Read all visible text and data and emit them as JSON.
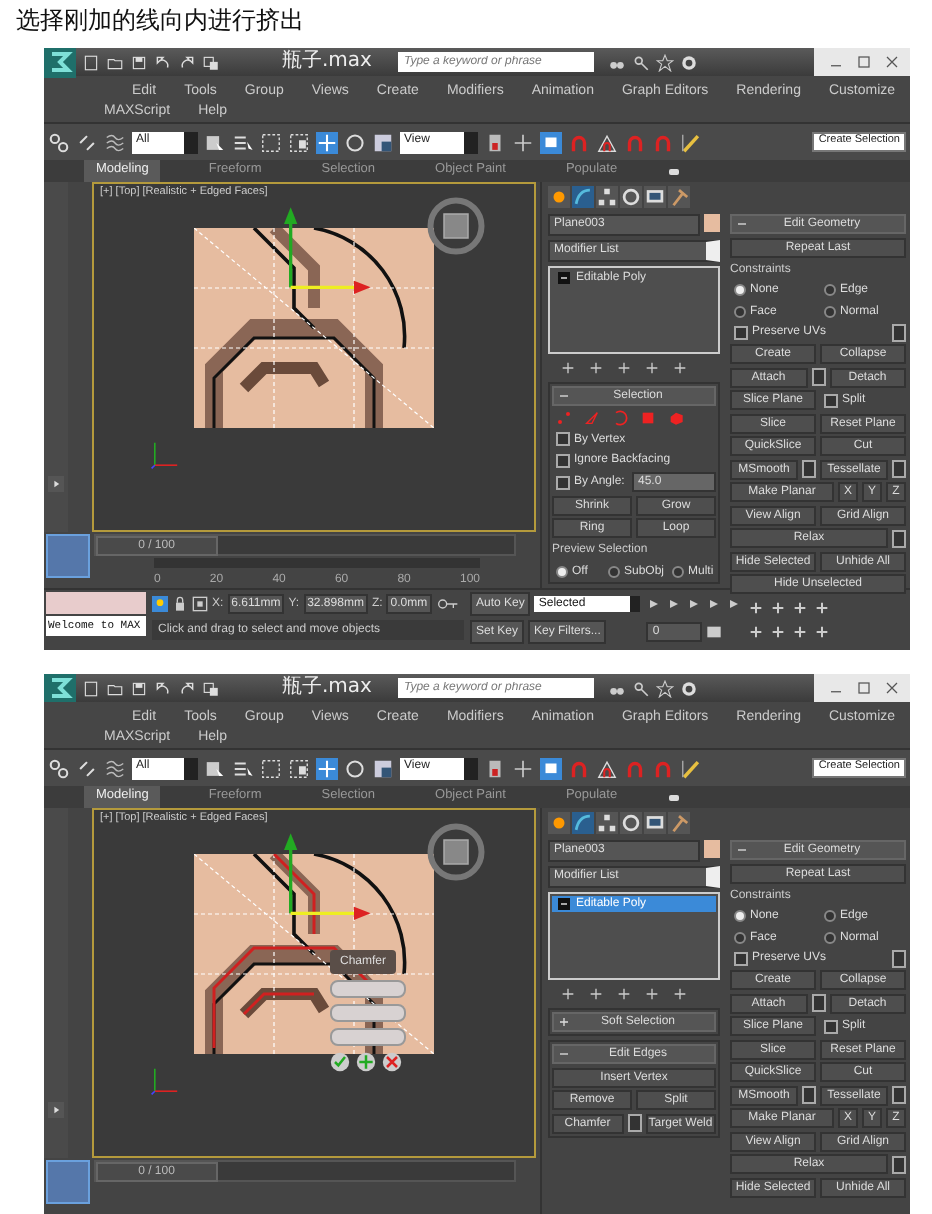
{
  "caption": "选择刚加的线向内进行挤出",
  "screenshots": [
    {
      "title": "瓶子.max",
      "search": {
        "placeholder": "Type a keyword or phrase"
      },
      "menus": [
        [
          "Edit",
          "Tools",
          "Group",
          "Views",
          "Create",
          "Modifiers",
          "Animation",
          "Graph Editors",
          "Rendering",
          "Customize"
        ],
        [
          "MAXScript",
          "Help"
        ]
      ],
      "toolbar": {
        "selection_filter": "All",
        "coordinate_system": "View",
        "named_selection": "Create Selection"
      },
      "ribbon_tabs": [
        {
          "label": "Modeling",
          "selected": true
        },
        {
          "label": "Freeform",
          "selected": false
        },
        {
          "label": "Selection",
          "selected": false
        },
        {
          "label": "Object Paint",
          "selected": false
        },
        {
          "label": "Populate",
          "selected": false
        }
      ],
      "viewport": {
        "label": "[+] [Top] [Realistic + Edged Faces]"
      },
      "object_name": "Plane003",
      "modifier_list": "Modifier List",
      "stack": [
        {
          "label": "Editable Poly",
          "selected": false
        }
      ],
      "rollouts": [
        {
          "title": "Selection",
          "expanded": true,
          "rows": [
            [
              {
                "kind": "subobject_icons"
              }
            ],
            [
              {
                "kind": "check",
                "label": "By Vertex",
                "checked": false
              }
            ],
            [
              {
                "kind": "check",
                "label": "Ignore Backfacing",
                "checked": false
              }
            ],
            [
              {
                "kind": "check",
                "label": "By Angle:",
                "checked": false
              },
              {
                "kind": "field",
                "value": "45.0"
              }
            ],
            [
              {
                "kind": "button",
                "label": "Shrink"
              },
              {
                "kind": "button",
                "label": "Grow"
              }
            ],
            [
              {
                "kind": "button",
                "label": "Ring"
              },
              {
                "kind": "button",
                "label": "Loop"
              }
            ],
            [
              {
                "kind": "legend",
                "label": "Preview Selection"
              }
            ],
            [
              {
                "kind": "radio",
                "label": "Off",
                "selected": true
              },
              {
                "kind": "radio",
                "label": "SubObj",
                "selected": false
              },
              {
                "kind": "radio",
                "label": "Multi",
                "selected": false
              }
            ]
          ]
        }
      ],
      "edit_geometry": {
        "title": "Edit Geometry",
        "rows": [
          [
            {
              "kind": "button",
              "label": "Repeat Last"
            }
          ],
          [
            {
              "kind": "legend",
              "label": "Constraints"
            }
          ],
          [
            {
              "kind": "radio",
              "label": "None",
              "selected": true
            },
            {
              "kind": "radio",
              "label": "Edge",
              "selected": false
            }
          ],
          [
            {
              "kind": "radio",
              "label": "Face",
              "selected": false
            },
            {
              "kind": "radio",
              "label": "Normal",
              "selected": false
            }
          ],
          [
            {
              "kind": "check",
              "label": "Preserve UVs",
              "checked": false
            },
            {
              "kind": "settings"
            }
          ],
          [
            {
              "kind": "button",
              "label": "Create"
            },
            {
              "kind": "button",
              "label": "Collapse"
            }
          ],
          [
            {
              "kind": "button",
              "label": "Attach"
            },
            {
              "kind": "settings"
            },
            {
              "kind": "button",
              "label": "Detach"
            }
          ],
          [
            {
              "kind": "button",
              "label": "Slice Plane"
            },
            {
              "kind": "check",
              "label": "Split",
              "checked": false
            }
          ],
          [
            {
              "kind": "button",
              "label": "Slice"
            },
            {
              "kind": "button",
              "label": "Reset Plane"
            }
          ],
          [
            {
              "kind": "button",
              "label": "QuickSlice"
            },
            {
              "kind": "button",
              "label": "Cut"
            }
          ],
          [
            {
              "kind": "button",
              "label": "MSmooth"
            },
            {
              "kind": "settings"
            },
            {
              "kind": "button",
              "label": "Tessellate"
            },
            {
              "kind": "settings"
            }
          ],
          [
            {
              "kind": "button",
              "label": "Make Planar"
            },
            {
              "kind": "small",
              "label": "X"
            },
            {
              "kind": "small",
              "label": "Y"
            },
            {
              "kind": "small",
              "label": "Z"
            }
          ],
          [
            {
              "kind": "button",
              "label": "View Align"
            },
            {
              "kind": "button",
              "label": "Grid Align"
            }
          ],
          [
            {
              "kind": "button",
              "label": "Relax"
            },
            {
              "kind": "settings"
            }
          ],
          [
            {
              "kind": "button",
              "label": "Hide Selected"
            },
            {
              "kind": "button",
              "label": "Unhide All"
            }
          ],
          [
            {
              "kind": "button",
              "label": "Hide Unselected"
            }
          ]
        ]
      },
      "timeline": {
        "frame": "0 / 100",
        "level": 0,
        "ticks": [
          "0",
          "20",
          "40",
          "60",
          "80",
          "100"
        ]
      },
      "status": {
        "prompt": "Welcome to MAX",
        "coords": [
          {
            "label": "X:",
            "value": "6.611mm"
          },
          {
            "label": "Y:",
            "value": "32.898mm"
          },
          {
            "label": "Z:",
            "value": "0.0mm"
          }
        ],
        "message": "Click and drag to select and move objects",
        "auto_key": "Auto Key",
        "key_mode": "Selected",
        "set_key": "Set Key",
        "key_filters": "Key Filters...",
        "current_frame": "0"
      }
    },
    {
      "title": "瓶子.max",
      "search": {
        "placeholder": "Type a keyword or phrase"
      },
      "menus": [
        [
          "Edit",
          "Tools",
          "Group",
          "Views",
          "Create",
          "Modifiers",
          "Animation",
          "Graph Editors",
          "Rendering",
          "Customize"
        ],
        [
          "MAXScript",
          "Help"
        ]
      ],
      "toolbar": {
        "selection_filter": "All",
        "coordinate_system": "View",
        "named_selection": "Create Selection"
      },
      "ribbon_tabs": [
        {
          "label": "Modeling",
          "selected": true
        },
        {
          "label": "Freeform",
          "selected": false
        },
        {
          "label": "Selection",
          "selected": false
        },
        {
          "label": "Object Paint",
          "selected": false
        },
        {
          "label": "Populate",
          "selected": false
        }
      ],
      "viewport": {
        "label": "[+] [Top] [Realistic + Edged Faces]",
        "caddy": {
          "title": "Chamfer"
        }
      },
      "object_name": "Plane003",
      "modifier_list": "Modifier List",
      "stack": [
        {
          "label": "Editable Poly",
          "selected": true
        }
      ],
      "rollouts": [
        {
          "title": "Soft Selection",
          "expanded": false
        },
        {
          "title": "Edit Edges",
          "expanded": true,
          "rows": [
            [
              {
                "kind": "button",
                "label": "Insert Vertex"
              }
            ],
            [
              {
                "kind": "button",
                "label": "Remove"
              },
              {
                "kind": "button",
                "label": "Split"
              }
            ],
            [
              {
                "kind": "button",
                "label": "Chamfer"
              },
              {
                "kind": "settings"
              },
              {
                "kind": "button",
                "label": "Target Weld"
              }
            ]
          ]
        }
      ],
      "edit_geometry": {
        "title": "Edit Geometry",
        "rows": [
          [
            {
              "kind": "button",
              "label": "Repeat Last"
            }
          ],
          [
            {
              "kind": "legend",
              "label": "Constraints"
            }
          ],
          [
            {
              "kind": "radio",
              "label": "None",
              "selected": true
            },
            {
              "kind": "radio",
              "label": "Edge",
              "selected": false
            }
          ],
          [
            {
              "kind": "radio",
              "label": "Face",
              "selected": false
            },
            {
              "kind": "radio",
              "label": "Normal",
              "selected": false
            }
          ],
          [
            {
              "kind": "check",
              "label": "Preserve UVs",
              "checked": false
            },
            {
              "kind": "settings"
            }
          ],
          [
            {
              "kind": "button",
              "label": "Create"
            },
            {
              "kind": "button",
              "label": "Collapse"
            }
          ],
          [
            {
              "kind": "button",
              "label": "Attach"
            },
            {
              "kind": "settings"
            },
            {
              "kind": "button",
              "label": "Detach"
            }
          ],
          [
            {
              "kind": "button",
              "label": "Slice Plane"
            },
            {
              "kind": "check",
              "label": "Split",
              "checked": false
            }
          ],
          [
            {
              "kind": "button",
              "label": "Slice"
            },
            {
              "kind": "button",
              "label": "Reset Plane"
            }
          ],
          [
            {
              "kind": "button",
              "label": "QuickSlice"
            },
            {
              "kind": "button",
              "label": "Cut"
            }
          ],
          [
            {
              "kind": "button",
              "label": "MSmooth"
            },
            {
              "kind": "settings"
            },
            {
              "kind": "button",
              "label": "Tessellate"
            },
            {
              "kind": "settings"
            }
          ],
          [
            {
              "kind": "button",
              "label": "Make Planar"
            },
            {
              "kind": "small",
              "label": "X"
            },
            {
              "kind": "small",
              "label": "Y"
            },
            {
              "kind": "small",
              "label": "Z"
            }
          ],
          [
            {
              "kind": "button",
              "label": "View Align"
            },
            {
              "kind": "button",
              "label": "Grid Align"
            }
          ],
          [
            {
              "kind": "button",
              "label": "Relax"
            },
            {
              "kind": "settings"
            }
          ],
          [
            {
              "kind": "button",
              "label": "Hide Selected"
            },
            {
              "kind": "button",
              "label": "Unhide All"
            }
          ]
        ]
      },
      "timeline": {
        "frame": "0 / 100",
        "level": 0
      }
    }
  ]
}
